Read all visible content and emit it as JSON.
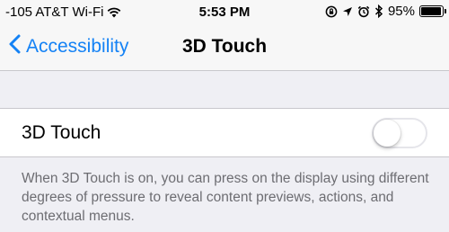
{
  "status_bar": {
    "carrier": "-105 AT&T Wi-Fi",
    "time": "5:53 PM",
    "battery_text": "95%",
    "battery_level": 0.95,
    "icons": [
      "wifi-icon",
      "rotation-lock-icon",
      "location-icon",
      "alarm-icon",
      "bluetooth-icon",
      "battery-icon"
    ]
  },
  "nav": {
    "back_label": "Accessibility",
    "title": "3D Touch"
  },
  "setting": {
    "label": "3D Touch",
    "enabled": false,
    "description": "When 3D Touch is on, you can press on the display using different degrees of pressure to reveal content previews, actions, and contextual menus."
  },
  "colors": {
    "accent": "#1482f5",
    "background": "#efeff4",
    "description_text": "#6d6d72"
  }
}
